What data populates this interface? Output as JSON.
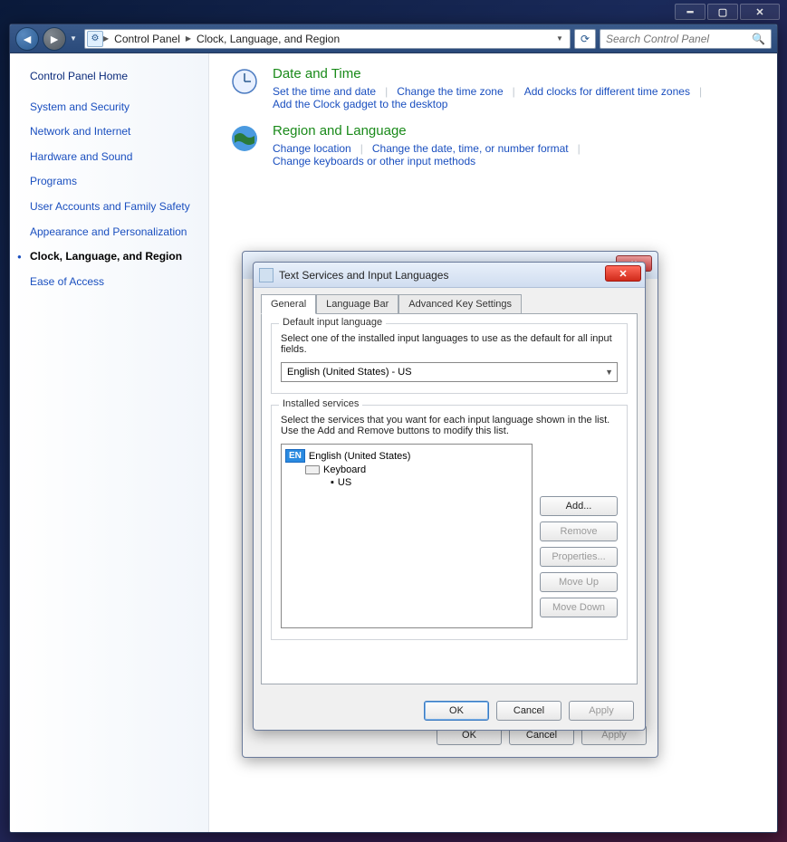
{
  "breadcrumbs": {
    "item1": "Control Panel",
    "item2": "Clock, Language, and Region"
  },
  "search": {
    "placeholder": "Search Control Panel"
  },
  "sidebar": {
    "home": "Control Panel Home",
    "items": [
      "System and Security",
      "Network and Internet",
      "Hardware and Sound",
      "Programs",
      "User Accounts and Family Safety",
      "Appearance and Personalization",
      "Clock, Language, and Region",
      "Ease of Access"
    ]
  },
  "categories": {
    "date_time": {
      "title": "Date and Time",
      "links": [
        "Set the time and date",
        "Change the time zone",
        "Add clocks for different time zones",
        "Add the Clock gadget to the desktop"
      ]
    },
    "region": {
      "title": "Region and Language",
      "links": [
        "Change location",
        "Change the date, time, or number format",
        "Change keyboards or other input methods"
      ]
    }
  },
  "dialog": {
    "title": "Text Services and Input Languages",
    "tabs": [
      "General",
      "Language Bar",
      "Advanced Key Settings"
    ],
    "default_group": {
      "label": "Default input language",
      "desc": "Select one of the installed input languages to use as the default for all input fields.",
      "combo_value": "English (United States) - US"
    },
    "services_group": {
      "label": "Installed services",
      "desc": "Select the services that you want for each input language shown in the list. Use the Add and Remove buttons to modify this list.",
      "tree": {
        "lang_badge": "EN",
        "lang": "English (United States)",
        "kb_label": "Keyboard",
        "kb_item": "US"
      },
      "buttons": {
        "add": "Add...",
        "remove": "Remove",
        "properties": "Properties...",
        "move_up": "Move Up",
        "move_down": "Move Down"
      }
    },
    "footer": {
      "ok": "OK",
      "cancel": "Cancel",
      "apply": "Apply"
    }
  },
  "back_dialog": {
    "footer": {
      "ok": "OK",
      "cancel": "Cancel",
      "apply": "Apply"
    }
  }
}
